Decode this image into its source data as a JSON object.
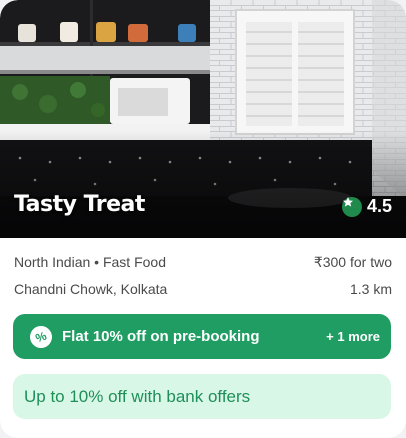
{
  "restaurant": {
    "name": "Tasty Treat",
    "rating": "4.5",
    "cuisines": "North Indian • Fast Food",
    "price": "₹300 for two",
    "location": "Chandni Chowk, Kolkata",
    "distance": "1.3 km"
  },
  "offers": {
    "primary": "Flat 10% off on pre-booking",
    "more": "+ 1 more",
    "bank": "Up to 10% off with bank offers"
  },
  "colors": {
    "accent": "#1f9d63",
    "bank_bg": "#d9f7e6",
    "bank_text": "#1f8f5a",
    "rating_badge": "#1f8a4c"
  },
  "icons": {
    "rating": "star-icon",
    "offer": "percent-badge-icon"
  }
}
